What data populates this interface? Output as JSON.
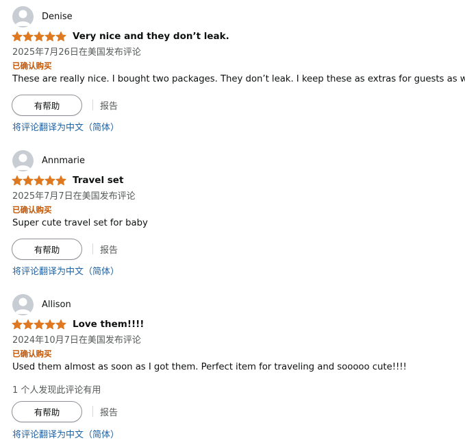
{
  "colors": {
    "star": "#de7921",
    "verified": "#c45500",
    "link": "#2162a1",
    "secondary_text": "#565959",
    "avatar_bg": "#c8cdd3"
  },
  "icons": {
    "avatar": "default-profile-avatar-icon",
    "star": "filled-star-icon"
  },
  "reviews": [
    {
      "name": "Denise",
      "rating": 5,
      "title": "Very nice and they don’t leak.",
      "date": "2025年7月26日在美国发布评论",
      "verified": "已确认购买",
      "body": "These are really nice. I bought two packages. They don’t leak. I keep these as extras for guests as well.",
      "helpful_count": "",
      "helpful_label": "有帮助",
      "report_label": "报告",
      "translate_label": "将评论翻译为中文（简体）"
    },
    {
      "name": "Annmarie",
      "rating": 5,
      "title": "Travel set",
      "date": "2025年7月7日在美国发布评论",
      "verified": "已确认购买",
      "body": "Super cute travel set for baby",
      "helpful_count": "",
      "helpful_label": "有帮助",
      "report_label": "报告",
      "translate_label": "将评论翻译为中文（简体）"
    },
    {
      "name": "Allison",
      "rating": 5,
      "title": "Love them!!!!",
      "date": "2024年10月7日在美国发布评论",
      "verified": "已确认购买",
      "body": "Used them almost as soon as I got them. Perfect item for traveling and sooooo cute!!!!",
      "helpful_count": "1 个人发现此评论有用",
      "helpful_label": "有帮助",
      "report_label": "报告",
      "translate_label": "将评论翻译为中文（简体）"
    }
  ]
}
